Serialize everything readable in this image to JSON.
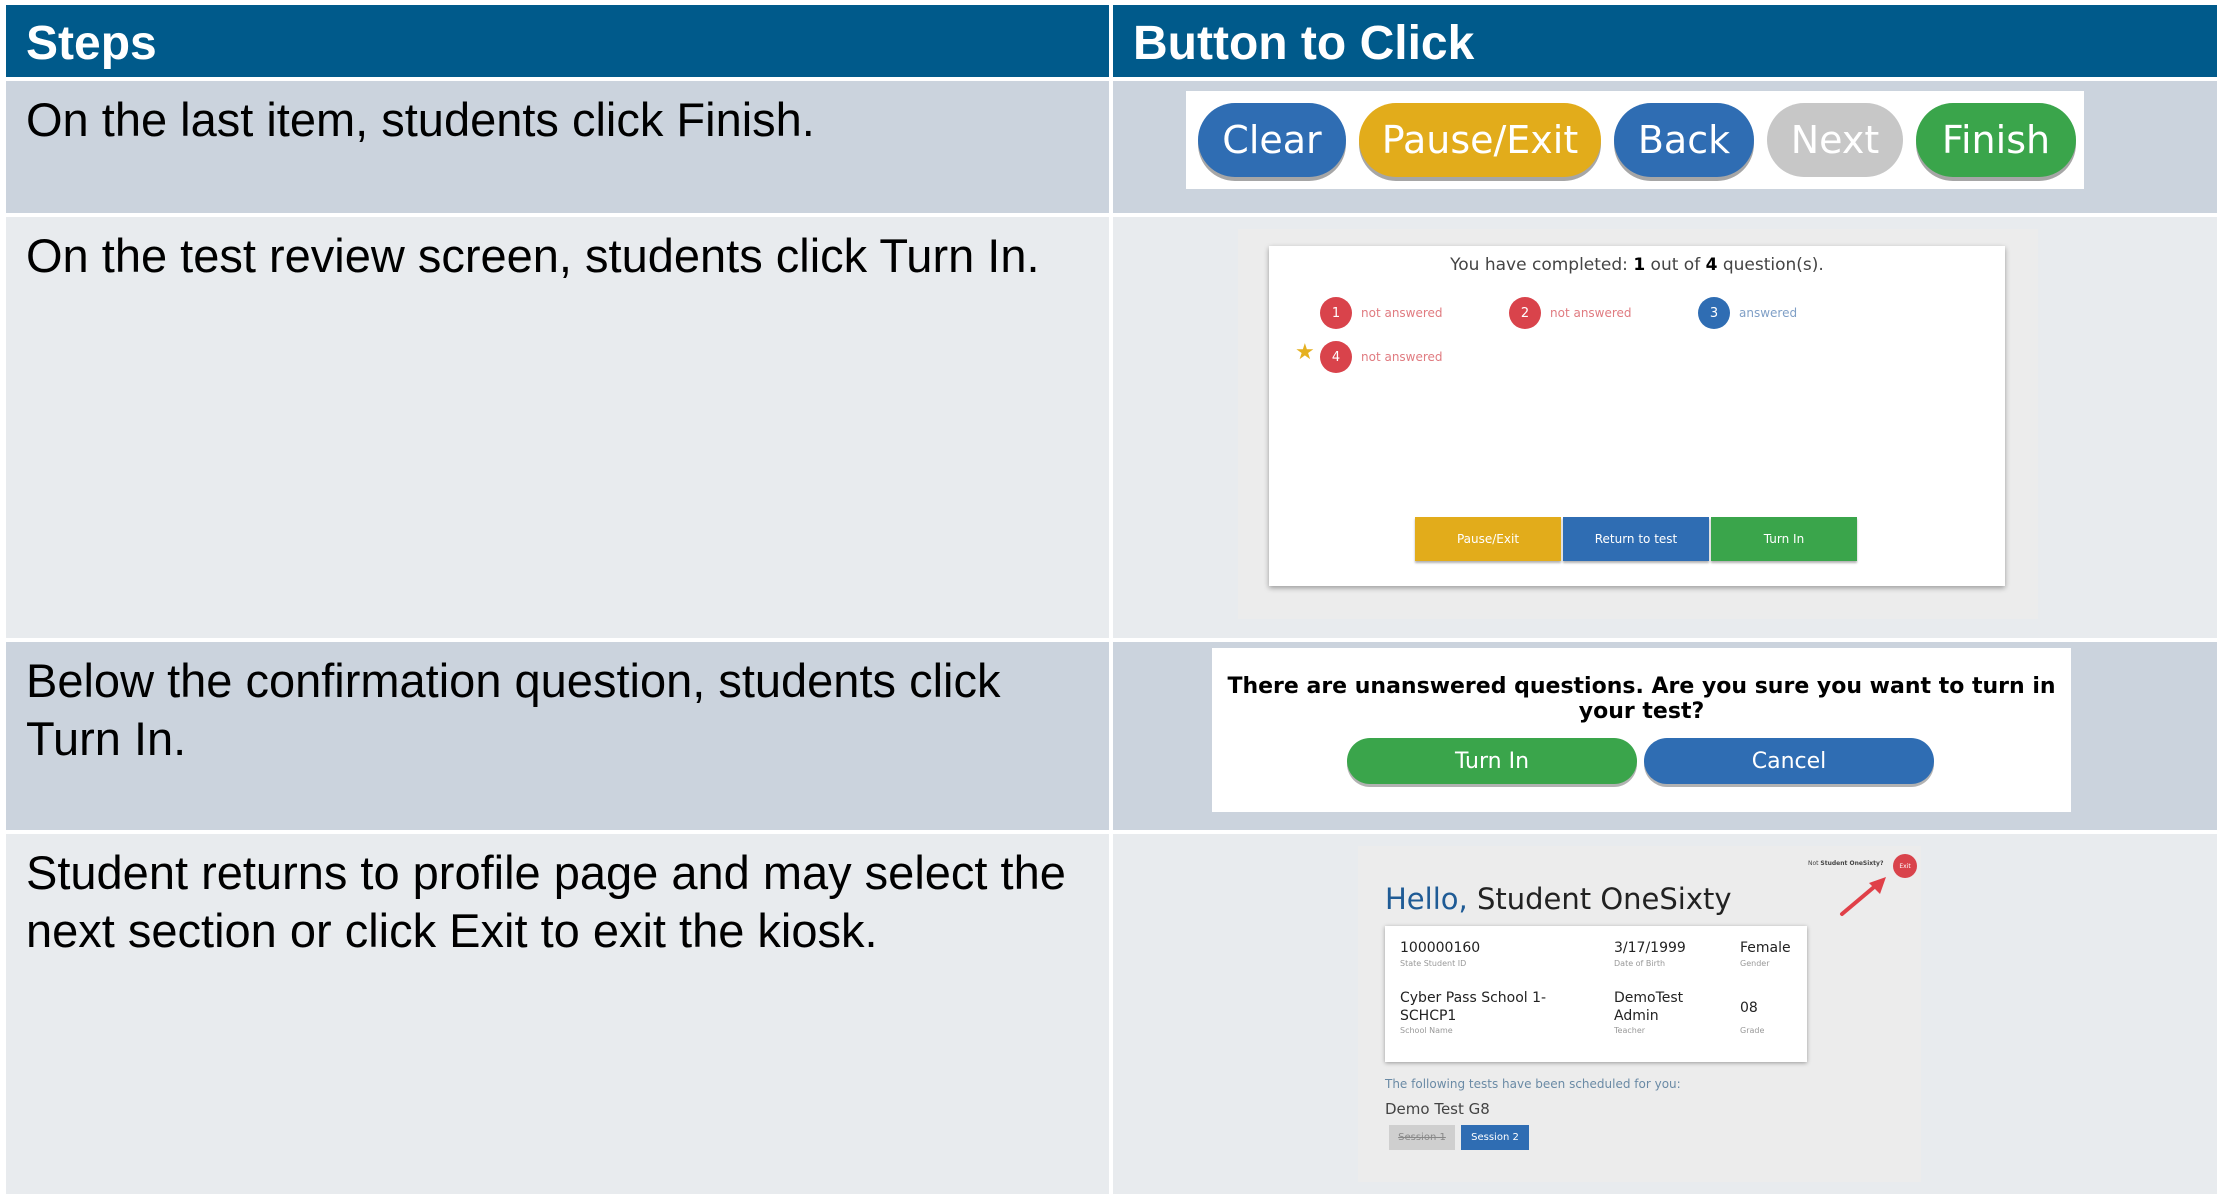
{
  "table": {
    "headers": [
      "Steps",
      "Button to Click"
    ],
    "steps": [
      "On the last item, students click Finish.",
      "On the test review screen, students click Turn In.",
      "Below the confirmation question, students click Turn In.",
      "Student returns to profile page and may select the next section or click Exit to exit the kiosk."
    ]
  },
  "nav_buttons": {
    "clear": "Clear",
    "pause_exit": "Pause/Exit",
    "back": "Back",
    "next": "Next",
    "finish": "Finish"
  },
  "review": {
    "completed_prefix": "You have completed: ",
    "completed_count": "1",
    "completed_mid": " out of ",
    "total_count": "4",
    "completed_suffix": " question(s).",
    "questions": [
      {
        "num": "1",
        "status": "not answered"
      },
      {
        "num": "2",
        "status": "not answered"
      },
      {
        "num": "3",
        "status": "answered"
      },
      {
        "num": "4",
        "status": "not answered"
      }
    ],
    "pause_exit": "Pause/Exit",
    "return_to_test": "Return to test",
    "turn_in": "Turn In"
  },
  "confirm": {
    "question": "There are unanswered questions. Are you sure you want to turn in your test?",
    "turn_in": "Turn In",
    "cancel": "Cancel"
  },
  "profile": {
    "not_prefix": "Not ",
    "not_name": "Student OneSixty?",
    "exit": "Exit",
    "hello": "Hello,",
    "name": "Student OneSixty",
    "state_id": "100000160",
    "state_id_label": "State Student ID",
    "dob": "3/17/1999",
    "dob_label": "Date of Birth",
    "gender": "Female",
    "gender_label": "Gender",
    "school_line1": "Cyber Pass School 1-",
    "school_line2": "SCHCP1",
    "school_label": "School Name",
    "teacher_line1": "DemoTest",
    "teacher_line2": "Admin",
    "teacher_label": "Teacher",
    "grade": "08",
    "grade_label": "Grade",
    "scheduled": "The following tests have been scheduled for you:",
    "test_name": "Demo Test G8",
    "session1": "Session 1",
    "session2": "Session 2"
  },
  "colors": {
    "header": "#005a8b",
    "clear": "#2f6db3",
    "pause": "#e2ac1b",
    "back": "#2f6db3",
    "next": "#c7c7c7",
    "finish": "#3aa54b",
    "not_answered": "#d9434b",
    "answered": "#2f6db3"
  }
}
